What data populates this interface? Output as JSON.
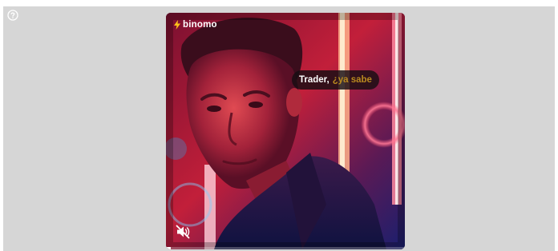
{
  "help": {
    "icon": "question-circle-icon"
  },
  "ad": {
    "brand_name": "binomo",
    "brand_icon": "lightning-bolt-icon",
    "caption_part1": "Trader,",
    "caption_part2": "¿ya sabe",
    "mute_icon": "speaker-muted-icon",
    "progress_fraction": 0.02
  },
  "colors": {
    "page_background": "#d6d6d6",
    "caption_highlight": "#b9891f",
    "neon_red": "#e8233f",
    "neon_blue": "#1c2a8c"
  }
}
